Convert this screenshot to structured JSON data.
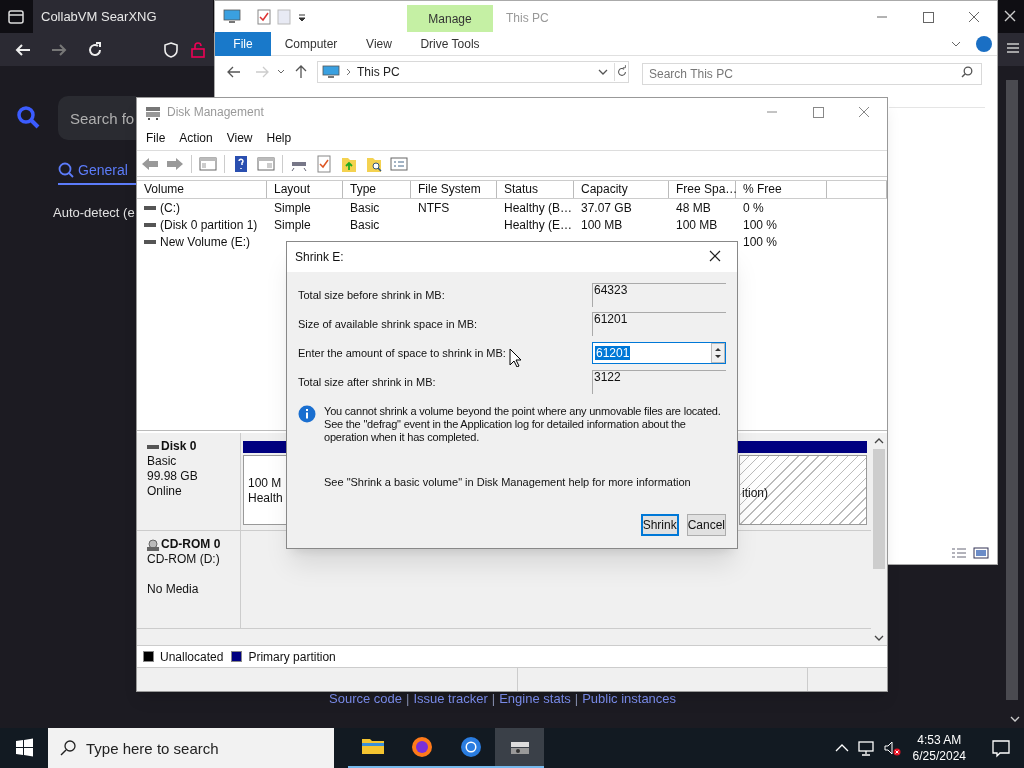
{
  "browser": {
    "tab_title": "CollabVM SearXNG",
    "search": {
      "placeholder": "Search fo"
    },
    "category_tab": {
      "label": "General",
      "selected": true
    },
    "language": "Auto-detect (e",
    "footer_links": [
      "Source code",
      "Issue tracker",
      "Engine stats",
      "Public instances"
    ],
    "footer_separator": "|"
  },
  "explorer": {
    "title": "This PC",
    "context_tab": "Manage",
    "ribbon_tabs": [
      {
        "label": "File",
        "selected": true
      },
      {
        "label": "Computer",
        "selected": false
      },
      {
        "label": "View",
        "selected": false
      },
      {
        "label": "Drive Tools",
        "selected": false
      }
    ],
    "address": "This PC",
    "search": {
      "placeholder": "Search This PC"
    }
  },
  "disk_management": {
    "title": "Disk Management",
    "menu": [
      "File",
      "Action",
      "View",
      "Help"
    ],
    "columns": [
      "Volume",
      "Layout",
      "Type",
      "File System",
      "Status",
      "Capacity",
      "Free Spa…",
      "% Free"
    ],
    "rows": [
      {
        "volume": "(C:)",
        "layout": "Simple",
        "type": "Basic",
        "file_system": "NTFS",
        "status": "Healthy (B…",
        "capacity": "37.07 GB",
        "free_space": "48 MB",
        "percent_free": "0 %"
      },
      {
        "volume": "(Disk 0 partition 1)",
        "layout": "Simple",
        "type": "Basic",
        "status": "Healthy (E…",
        "capacity": "100 MB",
        "free_space": "100 MB",
        "percent_free": "100 %"
      },
      {
        "volume": "New Volume (E:)",
        "percent_free": "100 %"
      }
    ],
    "disks": [
      {
        "kind": "disk",
        "name": "Disk 0",
        "lines": [
          "Basic",
          "99.98 GB",
          "Online"
        ],
        "partitions": [
          {
            "kind": "primary",
            "lines": [
              "100 M",
              "Health"
            ]
          },
          {
            "kind": "hatched",
            "lines": [
              "ition)"
            ]
          }
        ]
      },
      {
        "kind": "cdrom",
        "name": "CD-ROM 0",
        "lines": [
          "CD-ROM (D:)",
          "No Media"
        ]
      }
    ],
    "legend": [
      {
        "label": "Unallocated",
        "color": "#000000"
      },
      {
        "label": "Primary partition",
        "color": "#000080"
      }
    ]
  },
  "dialog": {
    "title": "Shrink E:",
    "fields": [
      {
        "label": "Total size before shrink in MB:",
        "value": "64323",
        "editable": false
      },
      {
        "label": "Size of available shrink space in MB:",
        "value": "61201",
        "editable": false
      },
      {
        "label": "Enter the amount of space to shrink in MB:",
        "value": "61201",
        "editable": true
      },
      {
        "label": "Total size after shrink in MB:",
        "value": "3122",
        "editable": false
      }
    ],
    "info": "You cannot shrink a volume beyond the point where any unmovable files are located. See the \"defrag\" event in the Application log for detailed information about the operation when it has completed.",
    "help": "See \"Shrink a basic volume\" in Disk Management help for more information",
    "buttons": [
      {
        "label": "Shrink",
        "default": true
      },
      {
        "label": "Cancel",
        "default": false
      }
    ]
  },
  "taskbar": {
    "search": {
      "placeholder": "Type here to search"
    },
    "apps": [
      {
        "kind": "folder",
        "active": false
      },
      {
        "kind": "firefox",
        "active": false
      },
      {
        "kind": "chromium",
        "active": false
      },
      {
        "kind": "diskmgmt",
        "active": true
      }
    ],
    "time": "4:53 AM",
    "date": "6/25/2024"
  }
}
